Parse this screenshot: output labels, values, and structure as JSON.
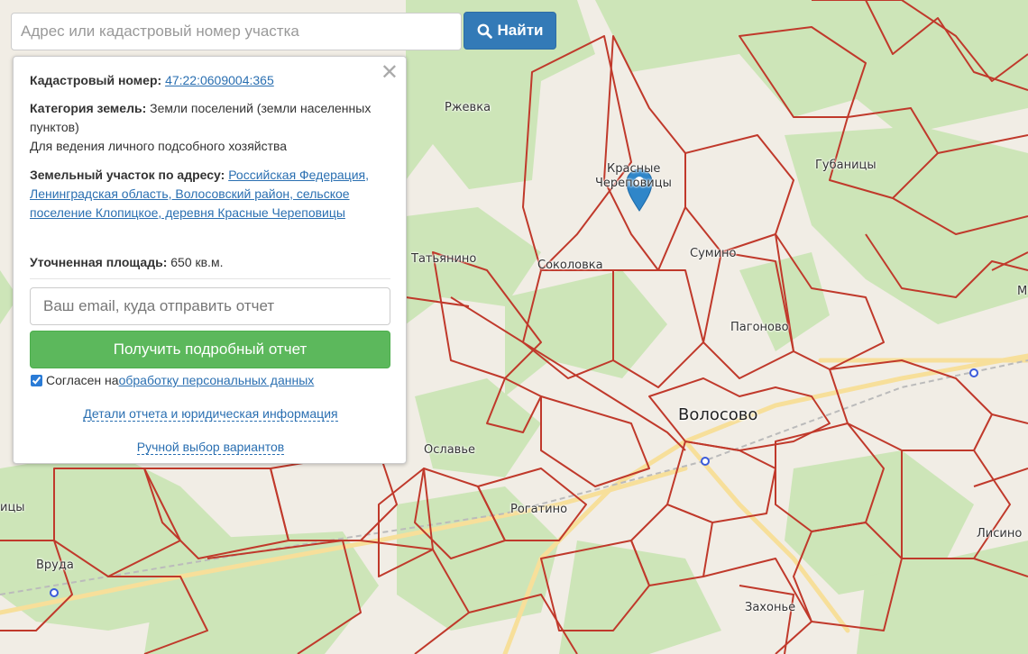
{
  "search": {
    "placeholder": "Адрес или кадастровый номер участка",
    "button_label": "Найти"
  },
  "popup": {
    "cadastral_label": "Кадастровый номер:",
    "cadastral_number": "47:22:0609004:365",
    "category_label": "Категория земель:",
    "category_value": "Земли поселений (земли населенных пунктов)",
    "usage": "Для ведения личного подсобного хозяйства",
    "address_label": "Земельный участок по адресу:",
    "address_value": "Российская Федерация, Ленинградская область, Волосовский район, сельское поселение Клопицкое, деревня Красные Череповицы",
    "area_label": "Уточненная площадь:",
    "area_value": "650 кв.м.",
    "email_placeholder": "Ваш email, куда отправить отчет",
    "report_button": "Получить подробный отчет",
    "agree_text": "Согласен на",
    "agree_link": "обработку персональных данных",
    "agree_checked": true,
    "details_link": "Детали отчета и юридическая информация",
    "manual_link": "Ручной выбор вариантов"
  },
  "map": {
    "colors": {
      "parcel": "#c0392b",
      "forest": "#cde5b8",
      "land": "#f1ede5",
      "road": "#f7df9a",
      "marker": "#2f86c9"
    },
    "places": [
      {
        "name": "Ржевка",
        "class": ""
      },
      {
        "name": "Красные",
        "class": ""
      },
      {
        "name": "Череповицы",
        "class": ""
      },
      {
        "name": "Губаницы",
        "class": ""
      },
      {
        "name": "Сумино",
        "class": ""
      },
      {
        "name": "Татьянино",
        "class": ""
      },
      {
        "name": "Соколовка",
        "class": ""
      },
      {
        "name": "Пагоново",
        "class": ""
      },
      {
        "name": "Волосово",
        "class": "big"
      },
      {
        "name": "Ославье",
        "class": ""
      },
      {
        "name": "Рогатино",
        "class": ""
      },
      {
        "name": "Вруда",
        "class": ""
      },
      {
        "name": "Захонье",
        "class": ""
      },
      {
        "name": "Лисино",
        "class": ""
      },
      {
        "name": "ицы",
        "class": ""
      },
      {
        "name": "М",
        "class": ""
      }
    ]
  }
}
